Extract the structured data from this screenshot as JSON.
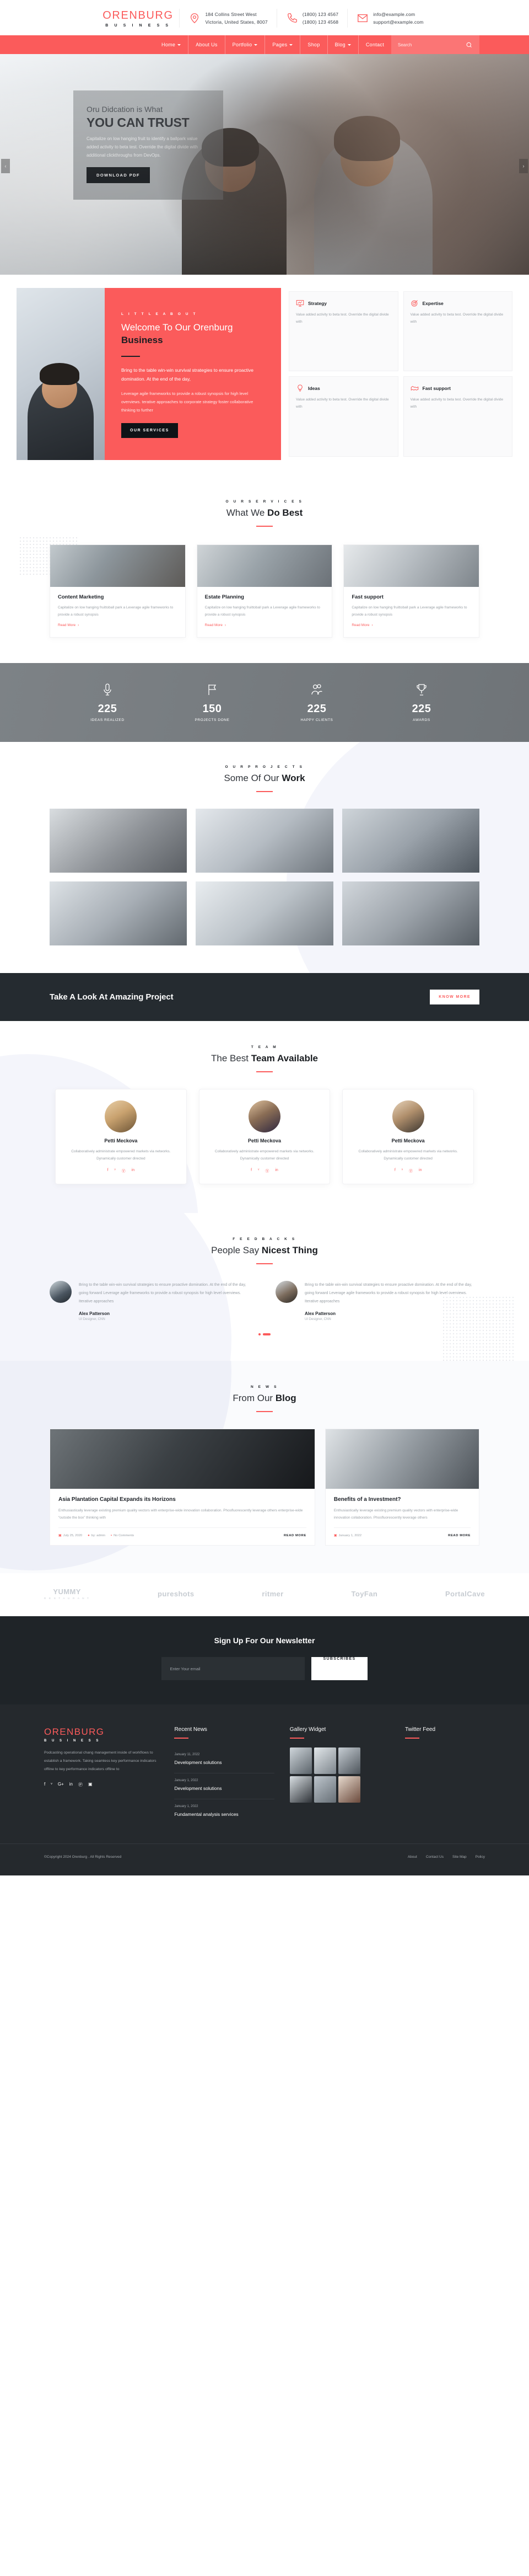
{
  "brand": {
    "name": "ORENBURG",
    "sub": "B U S I N E S S"
  },
  "topbar": {
    "address_icon": "map-pin-icon",
    "address_line1": "184 Collins Street West",
    "address_line2": "Victoria, United States, 8007",
    "phone_icon": "phone-icon",
    "phone1": "(1800) 123 4567",
    "phone2": "(1800) 123 4568",
    "mail_icon": "envelope-icon",
    "email1": "info@example.com",
    "email2": "support@example.com"
  },
  "nav": {
    "items": [
      {
        "label": "Home",
        "caret": true
      },
      {
        "label": "About Us",
        "caret": false
      },
      {
        "label": "Portfolio",
        "caret": true
      },
      {
        "label": "Pages",
        "caret": true
      },
      {
        "label": "Shop",
        "caret": false
      },
      {
        "label": "Blog",
        "caret": true
      },
      {
        "label": "Contact",
        "caret": false
      }
    ],
    "search_placeholder": "Search",
    "search_value": "",
    "search_icon": "search-icon",
    "accent": "#fb5b5b"
  },
  "hero": {
    "subtitle": "Oru Didcation is What",
    "title": "YOU CAN TRUST",
    "paragraph": "Capitalize on low hanging fruit to identify a ballpark value added activity to beta test. Override the digital divide with additional clickthroughs from DevOps.",
    "button": "DOWNLOAD PDF",
    "prev": "‹",
    "next": "›"
  },
  "about": {
    "eyebrow": "L I T T L E   A B O U T",
    "title_light": "Welcome To Our Orenburg ",
    "title_bold": "Business",
    "lead": "Bring to the table win-win survival strategies to ensure proactive domination. At the end of the day,",
    "paragraph": "Leverage agile frameworks to provide a robust synopsis for high level overviews. terative approaches to corporate strategy foster collaborative thinking to further",
    "button": "OUR SERVICES",
    "features": [
      {
        "icon": "monitor-chart-icon",
        "title": "Strategy",
        "text": "Value added activity to beta test. Override the digital divide with"
      },
      {
        "icon": "target-icon",
        "title": "Expertise",
        "text": "Value added activity to beta test. Override the digital divide with"
      },
      {
        "icon": "lightbulb-icon",
        "title": "Ideas",
        "text": "Value added activity to beta test. Override the digital divide with"
      },
      {
        "icon": "handshake-icon",
        "title": "Fast support",
        "text": "Value added activity to beta test. Override the digital divide with"
      }
    ]
  },
  "services": {
    "eyebrow": "O U R   S E R V I C E S",
    "title_light": "What We ",
    "title_bold": "Do Best",
    "cards": [
      {
        "title": "Content Marketing",
        "text": "Capitalize on low hanging fruittoball park a Leverage agile frameworks to provide a robust synopsis",
        "read_more": "Read More"
      },
      {
        "title": "Estate Planning",
        "text": "Capitalize on low hanging fruittoball park a Leverage agile frameworks to provide a robust synopsis",
        "read_more": "Read More"
      },
      {
        "title": "Fast support",
        "text": "Capitalize on low hanging fruittoball park a Leverage agile frameworks to provide a robust synopsis",
        "read_more": "Read More"
      }
    ]
  },
  "counters": [
    {
      "icon": "microphone-icon",
      "number": "225",
      "label": "IDEAS REALIZED"
    },
    {
      "icon": "flag-icon",
      "number": "150",
      "label": "PROJECTS DONE"
    },
    {
      "icon": "users-icon",
      "number": "225",
      "label": "HAPPY CLIENTS"
    },
    {
      "icon": "trophy-icon",
      "number": "225",
      "label": "AWARDS"
    }
  ],
  "projects": {
    "eyebrow": "O U R   P R O J E C T S",
    "title_light": "Some Of Our ",
    "title_bold": "Work"
  },
  "cta": {
    "title": "Take A Look At Amazing Project",
    "button": "KNOW MORE"
  },
  "team": {
    "eyebrow": "T E A M",
    "title_light": "The Best ",
    "title_bold": "Team Available",
    "members": [
      {
        "name": "Petti Meckova",
        "text": "Collaboratively administrate empowered markets via  networks. Dynamically customer directed",
        "socials": [
          "f",
          "ᵛ",
          "Ⓥ",
          "in"
        ]
      },
      {
        "name": "Petti Meckova",
        "text": "Collaboratively administrate empowered markets via  networks. Dynamically customer directed",
        "socials": [
          "f",
          "ᵛ",
          "Ⓥ",
          "in"
        ]
      },
      {
        "name": "Petti Meckova",
        "text": "Collaboratively administrate empowered markets via  networks. Dynamically customer directed",
        "socials": [
          "f",
          "ᵛ",
          "Ⓥ",
          "in"
        ]
      }
    ]
  },
  "testimonials": {
    "eyebrow": "F E E D B A C K S",
    "title_light": "People Say ",
    "title_bold": "Nicest Thing",
    "items": [
      {
        "quote": "Bring to the table win-win survival strategies to ensure proactive domination. At the end of the day, going forward Leverage agile frameworks to provide a robust synopsis for high level overviews. Iterative approaches",
        "name": "Alex Patterson",
        "role": "UI Designer, CNN"
      },
      {
        "quote": "Bring to the table win-win survival strategies to ensure proactive domination. At the end of the day, going forward Leverage agile frameworks to provide a robust synopsis for high level overviews. Iterative approaches",
        "name": "Alex Patterson",
        "role": "UI Designer, CNN"
      }
    ]
  },
  "blog": {
    "eyebrow": "N E W S",
    "title_light": "From Our ",
    "title_bold": "Blog",
    "posts": [
      {
        "title": "Asia Plantation Capital Expands its Horizons",
        "text": "Enthusiastically leverage existing premium quality vectors with enterprise-wide innovation collaboration. Phosfluorescently leverage others enterprise-wide “outside the box” thinking with",
        "date": "July 25, 2020",
        "author": "by: admin",
        "comments": "No Comments",
        "read_more": "READ MORE"
      },
      {
        "title": "Benefits of a Investment?",
        "text": "Enthusiastically leverage existing premium quality vectors with enterprise-wide innovation collaboration. Phosfluorescently leverage others",
        "date": "January 1, 2022",
        "author": "",
        "comments": "",
        "read_more": "READ MORE"
      }
    ]
  },
  "brands": [
    {
      "name": "YUMMY",
      "sub": "R E S T A U R A N T"
    },
    {
      "name": "pureshots",
      "sub": ""
    },
    {
      "name": "ritmer",
      "sub": ""
    },
    {
      "name": "ToyFan",
      "sub": ""
    },
    {
      "name": "PortalCave",
      "sub": ""
    }
  ],
  "newsletter": {
    "title": "Sign Up For Our Newsletter",
    "placeholder": "Enter Your email",
    "value": "",
    "button": "SUBSCRIBES"
  },
  "footer": {
    "about_text": "Podcasting operational chang management inside of workflows to establish a framework. Taking seamless key performance indicators offline to key performance indicators offline to",
    "socials": [
      "f",
      "ᵛ",
      "G+",
      "in",
      "Ⓟ",
      "▣"
    ],
    "recent_news_title": "Recent News",
    "recent_news": [
      {
        "date": "January 11, 2022",
        "title": "Development solutions"
      },
      {
        "date": "January 1, 2022",
        "title": "Development solutions"
      },
      {
        "date": "January 1, 2022",
        "title": "Fundamental analysis services"
      }
    ],
    "gallery_title": "Gallery Widget",
    "twitter_title": "Twitter Feed",
    "copyright": "©Copyright 2024 Orenburg . All Rights Reserved",
    "links": [
      "About",
      "Contact Us",
      "Site Map",
      "Policy"
    ]
  }
}
